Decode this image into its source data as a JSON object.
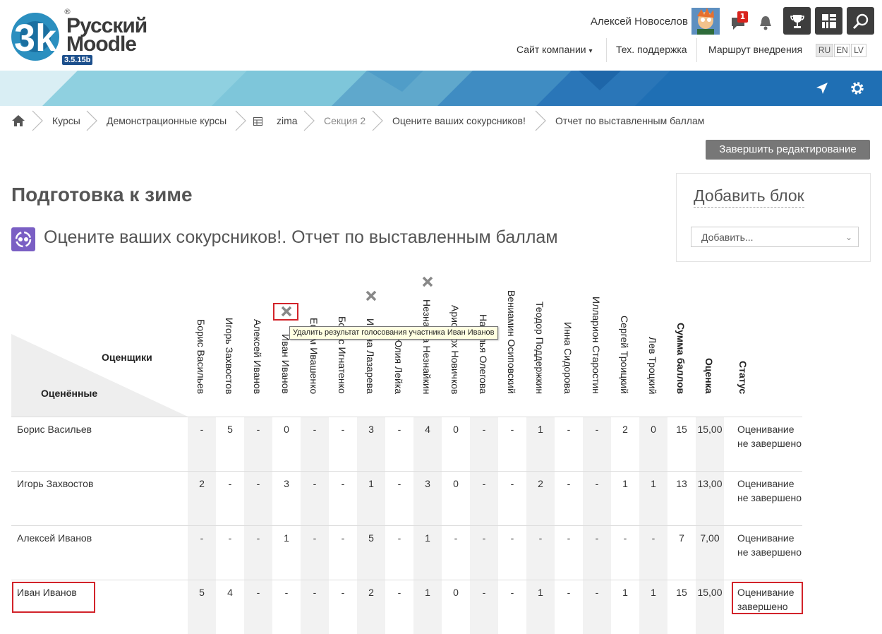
{
  "branding": {
    "logo_mark": "3k",
    "logo_line1": "Русский",
    "logo_line2": "Moodle",
    "registered": "®",
    "version": "3.5.15b"
  },
  "user": {
    "name": "Алексей Новоселов",
    "unread_messages": "1"
  },
  "nav": {
    "company_site": "Сайт компании",
    "company_site_caret": "▾",
    "support": "Тех. поддержка",
    "roadmap": "Маршрут внедрения",
    "languages": [
      "RU",
      "EN",
      "LV"
    ],
    "active_language": "RU"
  },
  "breadcrumb": [
    "Курсы",
    "Демонстрационные курсы",
    "zima",
    "Секция 2",
    "Оцените ваших сокурсников!",
    "Отчет по выставленным баллам"
  ],
  "finish_edit_label": "Завершить редактирование",
  "course_title": "Подготовка к зиме",
  "activity_title": "Оцените ваших сокурсников!. Отчет по выставленным баллам",
  "add_block": {
    "title": "Добавить блок",
    "select_value": "Добавить..."
  },
  "table": {
    "raters_label": "Оценщики",
    "rated_label": "Оценённые",
    "raters": [
      "Борис Васильев",
      "Игорь Захвостов",
      "Алексей Иванов",
      "Иван Иванов",
      "Ефим Ивашенко",
      "Борис Игнатенко",
      "Ирина Лазарева",
      "Юлия Лейка",
      "Незнайка Незнайкин",
      "Аристарх Новичков",
      "Наталья Олегова",
      "Вениамин Осиповский",
      "Теодор Поддержкин",
      "Инна Сидорова",
      "Илларион Старостин",
      "Сергей Троицкий",
      "Лев Троцкий"
    ],
    "sum_label": "Сумма баллов",
    "grade_label": "Оценка",
    "status_label": "Статус",
    "rows": [
      {
        "name": "Борис Васильев",
        "scores": [
          "-",
          "5",
          "-",
          "0",
          "-",
          "-",
          "3",
          "-",
          "4",
          "0",
          "-",
          "-",
          "1",
          "-",
          "-",
          "2",
          "0"
        ],
        "sum": "15",
        "grade": "15,00",
        "status": "Оценивание не завершено"
      },
      {
        "name": "Игорь Захвостов",
        "scores": [
          "2",
          "-",
          "-",
          "3",
          "-",
          "-",
          "1",
          "-",
          "3",
          "0",
          "-",
          "-",
          "2",
          "-",
          "-",
          "1",
          "1"
        ],
        "sum": "13",
        "grade": "13,00",
        "status": "Оценивание не завершено"
      },
      {
        "name": "Алексей Иванов",
        "scores": [
          "-",
          "-",
          "-",
          "1",
          "-",
          "-",
          "5",
          "-",
          "1",
          "-",
          "-",
          "-",
          "-",
          "-",
          "-",
          "-",
          "-"
        ],
        "sum": "7",
        "grade": "7,00",
        "status": "Оценивание не завершено"
      },
      {
        "name": "Иван Иванов",
        "scores": [
          "5",
          "4",
          "-",
          "-",
          "-",
          "-",
          "2",
          "-",
          "1",
          "0",
          "-",
          "-",
          "1",
          "-",
          "-",
          "1",
          "1"
        ],
        "sum": "15",
        "grade": "15,00",
        "status": "Оценивание завершено"
      }
    ]
  },
  "tooltip": "Удалить результат голосования участника Иван Иванов",
  "colors": {
    "accent_red": "#d2232a",
    "banner_blue": "#1f73b5",
    "activity_purple": "#7a5fc4"
  }
}
